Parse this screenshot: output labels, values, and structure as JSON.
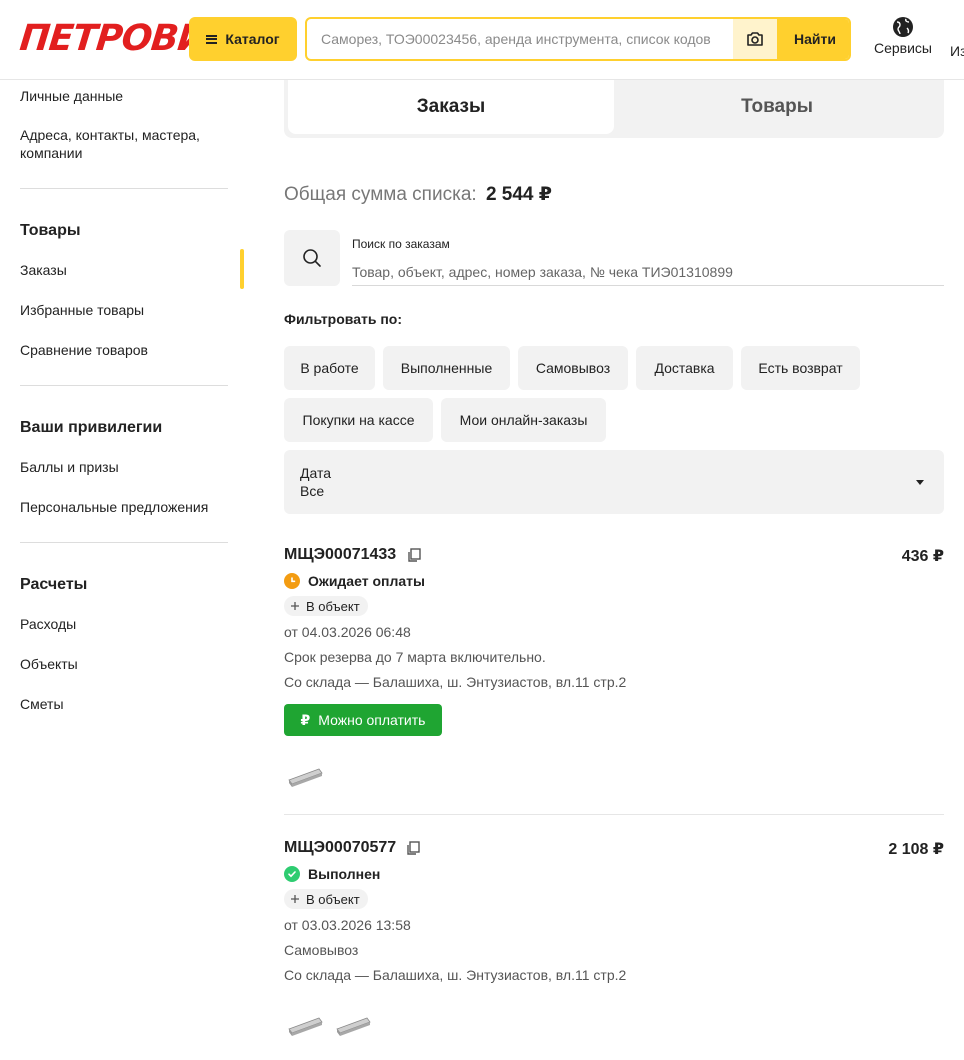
{
  "header": {
    "logo": "ПЕТРОВИЧ",
    "catalog_label": "Каталог",
    "search_placeholder": "Саморез, ТОЭ00023456, аренда инструмента, список кодов",
    "find_label": "Найти",
    "services_label": "Сервисы",
    "overflow_label": "Из"
  },
  "sidebar": {
    "top_items": [
      "Личные данные",
      "Адреса, контакты, мастера, компании"
    ],
    "sections": [
      {
        "title": "Товары",
        "items": [
          "Заказы",
          "Избранные товары",
          "Сравнение товаров"
        ]
      },
      {
        "title": "Ваши привилегии",
        "items": [
          "Баллы и призы",
          "Персональные предложения"
        ]
      },
      {
        "title": "Расчеты",
        "items": [
          "Расходы",
          "Объекты",
          "Сметы"
        ]
      }
    ],
    "active_item": "Заказы"
  },
  "tabs": [
    "Заказы",
    "Товары"
  ],
  "total": {
    "label": "Общая сумма списка:",
    "value": "2 544 ₽"
  },
  "orders_search": {
    "label": "Поиск по заказам",
    "placeholder": "Товар, объект, адрес, номер заказа, № чека ТИЭ01310899"
  },
  "filter": {
    "label": "Фильтровать по:",
    "chips": [
      "В работе",
      "Выполненные",
      "Самовывоз",
      "Доставка",
      "Есть возврат",
      "Покупки на кассе",
      "Мои онлайн-заказы"
    ]
  },
  "date_filter": {
    "label": "Дата",
    "value": "Все"
  },
  "orders": [
    {
      "number": "МЩЭ00071433",
      "sum": "436 ₽",
      "status": "Ожидает оплаты",
      "status_color": "#f39c12",
      "tag": "В объект",
      "date": "от 04.03.2026 06:48",
      "note": "Срок резерва до 7 марта включительно.",
      "source": "Со склада — Балашиха, ш. Энтузиастов, вл.11 стр.2",
      "pay_label": "Можно оплатить"
    },
    {
      "number": "МЩЭ00070577",
      "sum": "2 108 ₽",
      "status": "Выполнен",
      "status_color": "#2ecc71",
      "tag": "В объект",
      "date": "от 03.03.2026 13:58",
      "note": "Самовывоз",
      "source": "Со склада — Балашиха, ш. Энтузиастов, вл.11 стр.2"
    }
  ],
  "colors": {
    "accent": "#ffd02e",
    "brand": "#e21f1f",
    "pay": "#1fa532"
  }
}
